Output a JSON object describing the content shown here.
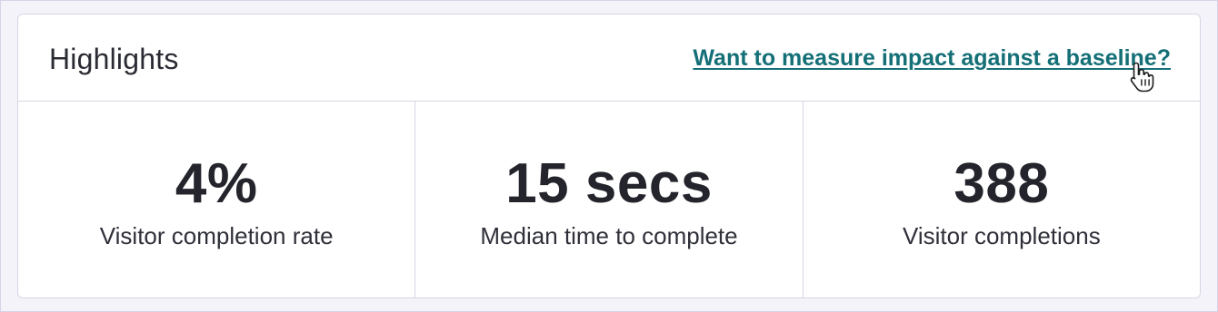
{
  "highlights": {
    "title": "Highlights",
    "baseline_link": "Want to measure impact against a baseline?",
    "stats": [
      {
        "value": "4%",
        "label": "Visitor completion rate"
      },
      {
        "value": "15 secs",
        "label": "Median time to complete"
      },
      {
        "value": "388",
        "label": "Visitor completions"
      }
    ]
  },
  "colors": {
    "link": "#146f77",
    "text": "#24252c",
    "border": "#d8d6e4",
    "background": "#f4f3fa"
  },
  "icons": {
    "cursor": "hand-pointer-icon"
  }
}
